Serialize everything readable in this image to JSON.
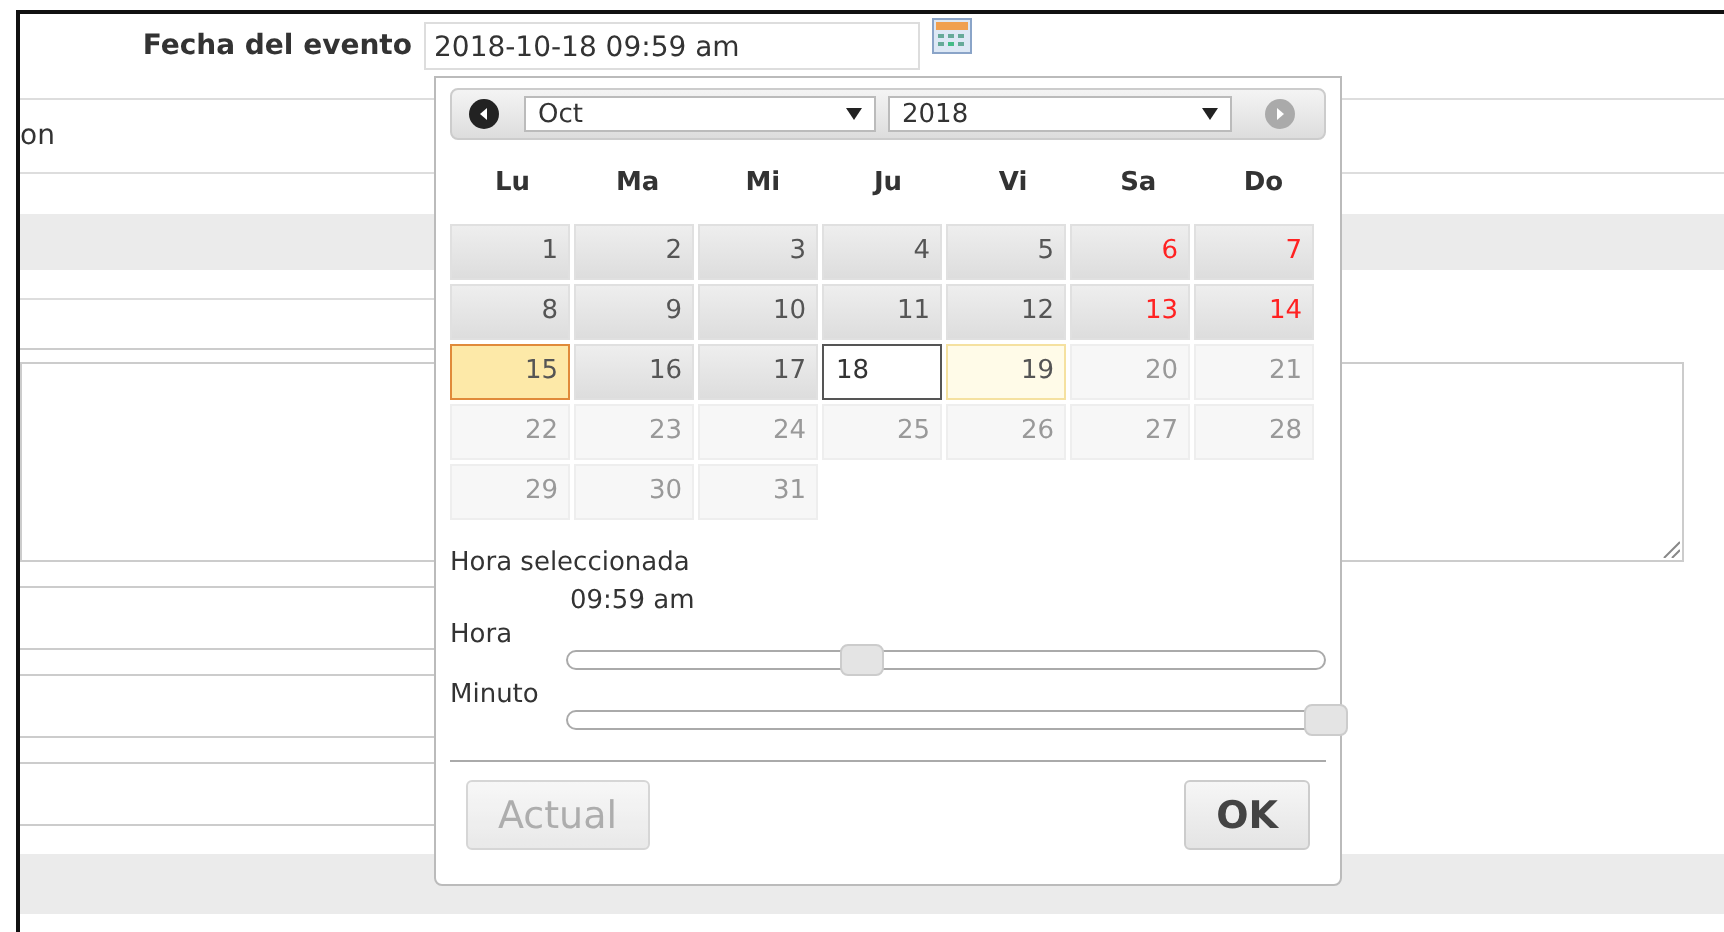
{
  "form": {
    "label": "Fecha del evento",
    "value": "2018-10-18 09:59 am",
    "cut_label": "on"
  },
  "datepicker": {
    "prev": {
      "disabled": false
    },
    "next": {
      "disabled": true
    },
    "month": "Oct",
    "year": "2018",
    "weekdays": [
      {
        "label": "Lu"
      },
      {
        "label": "Ma"
      },
      {
        "label": "Mi"
      },
      {
        "label": "Ju"
      },
      {
        "label": "Vi"
      },
      {
        "label": "Sa"
      },
      {
        "label": "Do"
      }
    ],
    "days": [
      {
        "label": "1",
        "weekend": false,
        "disabled": false,
        "today": false,
        "selected": false,
        "hover": false
      },
      {
        "label": "2",
        "weekend": false,
        "disabled": false,
        "today": false,
        "selected": false,
        "hover": false
      },
      {
        "label": "3",
        "weekend": false,
        "disabled": false,
        "today": false,
        "selected": false,
        "hover": false
      },
      {
        "label": "4",
        "weekend": false,
        "disabled": false,
        "today": false,
        "selected": false,
        "hover": false
      },
      {
        "label": "5",
        "weekend": false,
        "disabled": false,
        "today": false,
        "selected": false,
        "hover": false
      },
      {
        "label": "6",
        "weekend": true,
        "disabled": false,
        "today": false,
        "selected": false,
        "hover": false
      },
      {
        "label": "7",
        "weekend": true,
        "disabled": false,
        "today": false,
        "selected": false,
        "hover": false
      },
      {
        "label": "8",
        "weekend": false,
        "disabled": false,
        "today": false,
        "selected": false,
        "hover": false
      },
      {
        "label": "9",
        "weekend": false,
        "disabled": false,
        "today": false,
        "selected": false,
        "hover": false
      },
      {
        "label": "10",
        "weekend": false,
        "disabled": false,
        "today": false,
        "selected": false,
        "hover": false
      },
      {
        "label": "11",
        "weekend": false,
        "disabled": false,
        "today": false,
        "selected": false,
        "hover": false
      },
      {
        "label": "12",
        "weekend": false,
        "disabled": false,
        "today": false,
        "selected": false,
        "hover": false
      },
      {
        "label": "13",
        "weekend": true,
        "disabled": false,
        "today": false,
        "selected": false,
        "hover": false
      },
      {
        "label": "14",
        "weekend": true,
        "disabled": false,
        "today": false,
        "selected": false,
        "hover": false
      },
      {
        "label": "15",
        "weekend": false,
        "disabled": false,
        "today": true,
        "selected": false,
        "hover": false
      },
      {
        "label": "16",
        "weekend": false,
        "disabled": false,
        "today": false,
        "selected": false,
        "hover": false
      },
      {
        "label": "17",
        "weekend": false,
        "disabled": false,
        "today": false,
        "selected": false,
        "hover": false
      },
      {
        "label": "18",
        "weekend": false,
        "disabled": false,
        "today": false,
        "selected": true,
        "hover": false
      },
      {
        "label": "19",
        "weekend": false,
        "disabled": false,
        "today": false,
        "selected": false,
        "hover": true
      },
      {
        "label": "20",
        "weekend": true,
        "disabled": true,
        "today": false,
        "selected": false,
        "hover": false
      },
      {
        "label": "21",
        "weekend": true,
        "disabled": true,
        "today": false,
        "selected": false,
        "hover": false
      },
      {
        "label": "22",
        "weekend": false,
        "disabled": true,
        "today": false,
        "selected": false,
        "hover": false
      },
      {
        "label": "23",
        "weekend": false,
        "disabled": true,
        "today": false,
        "selected": false,
        "hover": false
      },
      {
        "label": "24",
        "weekend": false,
        "disabled": true,
        "today": false,
        "selected": false,
        "hover": false
      },
      {
        "label": "25",
        "weekend": false,
        "disabled": true,
        "today": false,
        "selected": false,
        "hover": false
      },
      {
        "label": "26",
        "weekend": false,
        "disabled": true,
        "today": false,
        "selected": false,
        "hover": false
      },
      {
        "label": "27",
        "weekend": true,
        "disabled": true,
        "today": false,
        "selected": false,
        "hover": false
      },
      {
        "label": "28",
        "weekend": true,
        "disabled": true,
        "today": false,
        "selected": false,
        "hover": false
      },
      {
        "label": "29",
        "weekend": false,
        "disabled": true,
        "today": false,
        "selected": false,
        "hover": false
      },
      {
        "label": "30",
        "weekend": false,
        "disabled": true,
        "today": false,
        "selected": false,
        "hover": false
      },
      {
        "label": "31",
        "weekend": false,
        "disabled": true,
        "today": false,
        "selected": false,
        "hover": false
      }
    ],
    "time_label": "Hora seleccionada",
    "time": "09:59 am",
    "sliders": [
      {
        "label": "Hora",
        "level": 0.39
      },
      {
        "label": "Minuto",
        "level": 1
      }
    ],
    "buttons": [
      {
        "label": "Actual",
        "disabled": true,
        "kind": "now"
      },
      {
        "label": "OK",
        "disabled": false,
        "kind": "ok"
      }
    ]
  }
}
